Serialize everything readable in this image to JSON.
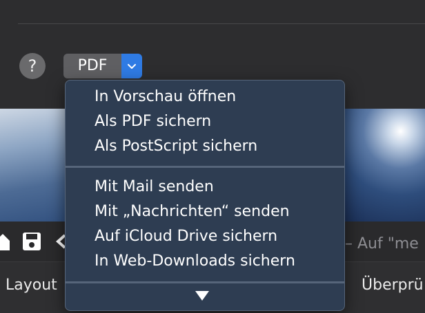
{
  "toolbar": {
    "help_label": "?",
    "pdf_label": "PDF"
  },
  "menu": {
    "group1": [
      "In Vorschau öffnen",
      "Als PDF sichern",
      "Als PostScript sichern"
    ],
    "group2": [
      "Mit Mail senden",
      "Mit „Nachrichten“ senden",
      "Auf iCloud Drive sichern",
      "In Web-Downloads sichern"
    ]
  },
  "browser": {
    "search_hint": "– Auf \"me"
  },
  "tabs": {
    "layout": "Layout",
    "review": "Überprü"
  },
  "icons": {
    "help": "question-icon",
    "dropdown": "chevron-down-icon",
    "home": "home-icon",
    "save": "floppy-disk-icon",
    "back": "back-arrow-icon",
    "scroll": "triangle-down-icon"
  },
  "colors": {
    "accent": "#2f7be4",
    "menu_bg": "#2e3d52"
  }
}
